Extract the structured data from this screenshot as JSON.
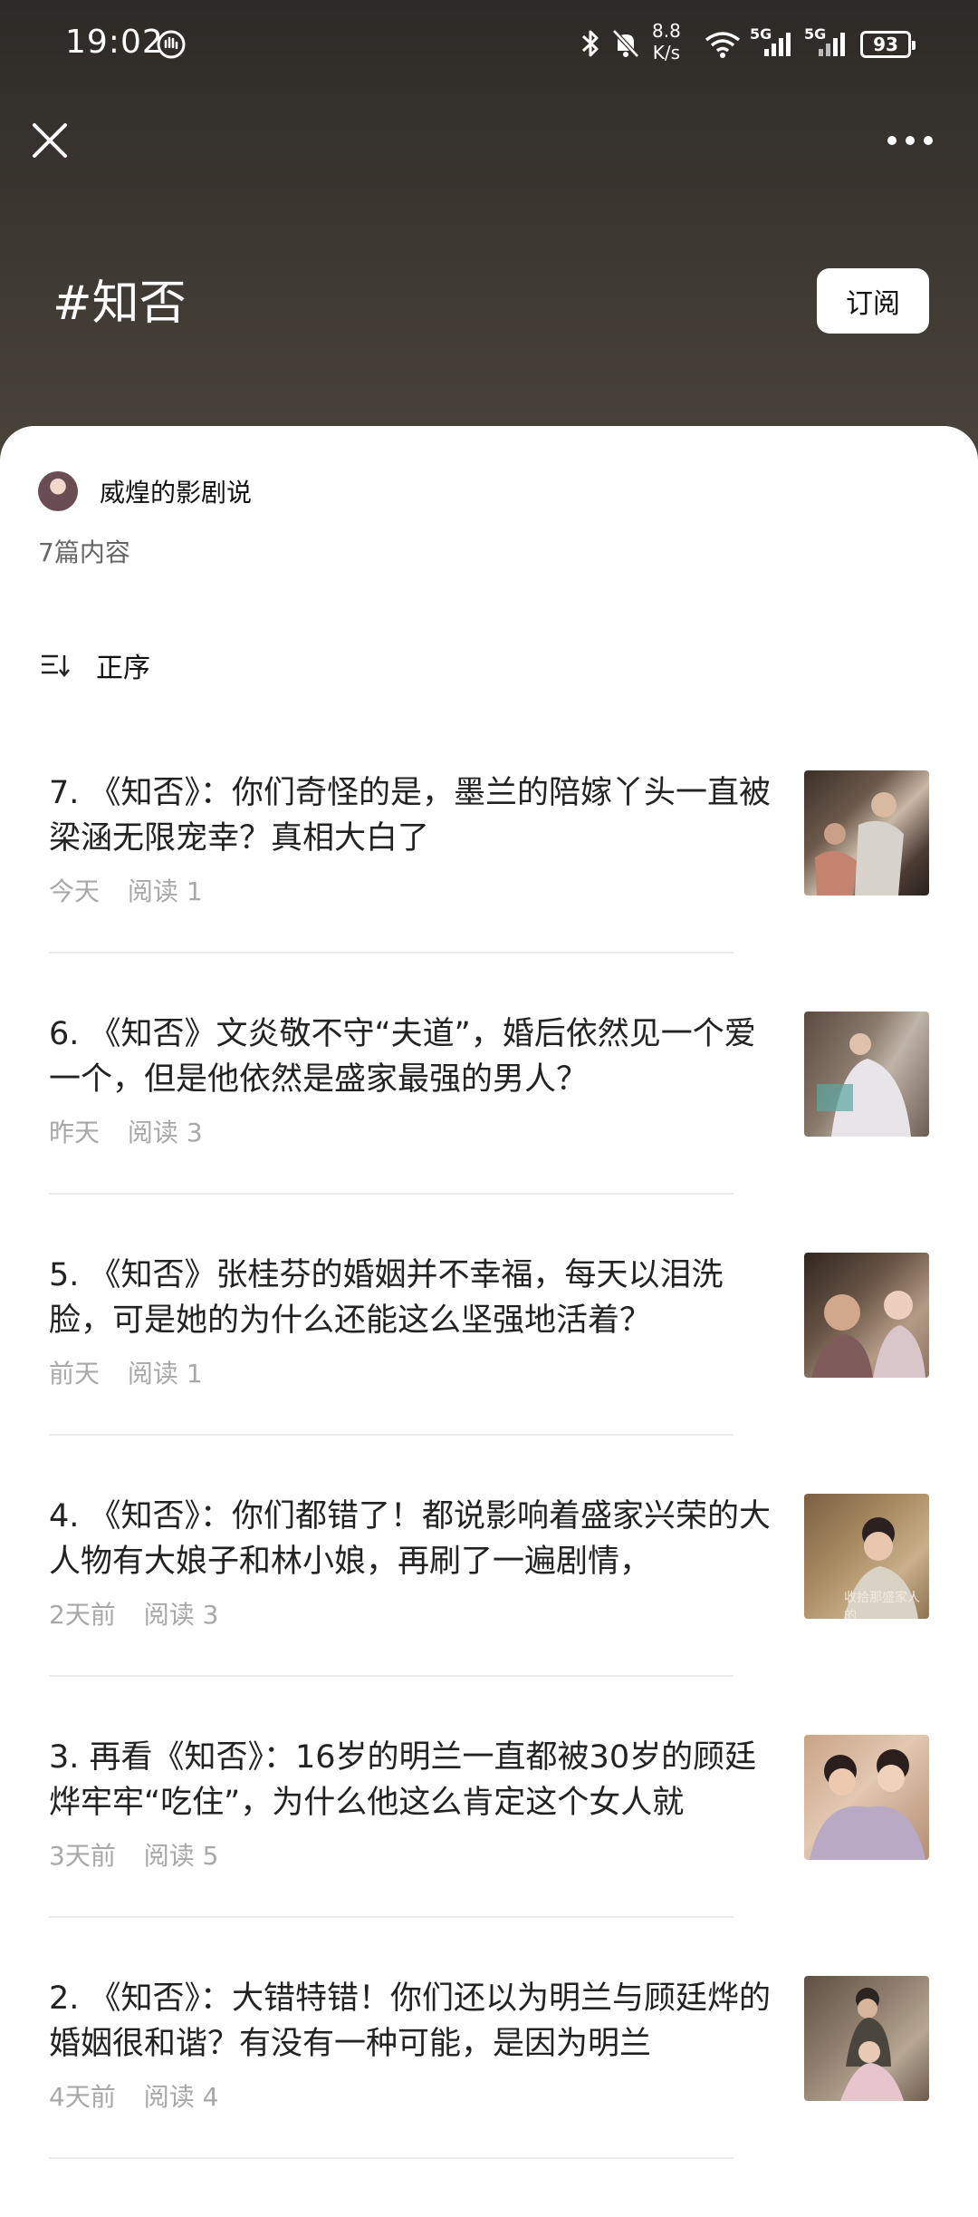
{
  "status": {
    "time": "19:02",
    "speed_value": "8.8",
    "speed_unit": "K/s",
    "battery": "93",
    "signal_a": "5G",
    "signal_b": "5G"
  },
  "header": {
    "title": "#知否",
    "subscribe_label": "订阅"
  },
  "author": {
    "name": "威煌的影剧说"
  },
  "count_label": "7篇内容",
  "sort_label": "正序",
  "items": [
    {
      "title": "7. 《知否》：你们奇怪的是，墨兰的陪嫁丫头一直被梁涵无限宠幸？真相大白了",
      "date": "今天",
      "reads": "阅读 1"
    },
    {
      "title": "6. 《知否》文炎敬不守“夫道”，婚后依然见一个爱一个，但是他依然是盛家最强的男人？",
      "date": "昨天",
      "reads": "阅读 3"
    },
    {
      "title": "5. 《知否》张桂芬的婚姻并不幸福，每天以泪洗脸，可是她的为什么还能这么坚强地活着？",
      "date": "前天",
      "reads": "阅读 1"
    },
    {
      "title": "4. 《知否》：你们都错了！都说影响着盛家兴荣的大人物有大娘子和林小娘，再刷了一遍剧情，",
      "date": "2天前",
      "reads": "阅读 3",
      "thumb_caption": "收拾那盛家人的"
    },
    {
      "title": "3. 再看《知否》：16岁的明兰一直都被30岁的顾廷烨牢牢“吃住”，为什么他这么肯定这个女人就",
      "date": "3天前",
      "reads": "阅读 5"
    },
    {
      "title": "2. 《知否》：大错特错！你们还以为明兰与顾廷烨的婚姻很和谐？有没有一种可能，是因为明兰",
      "date": "4天前",
      "reads": "阅读 4"
    }
  ]
}
